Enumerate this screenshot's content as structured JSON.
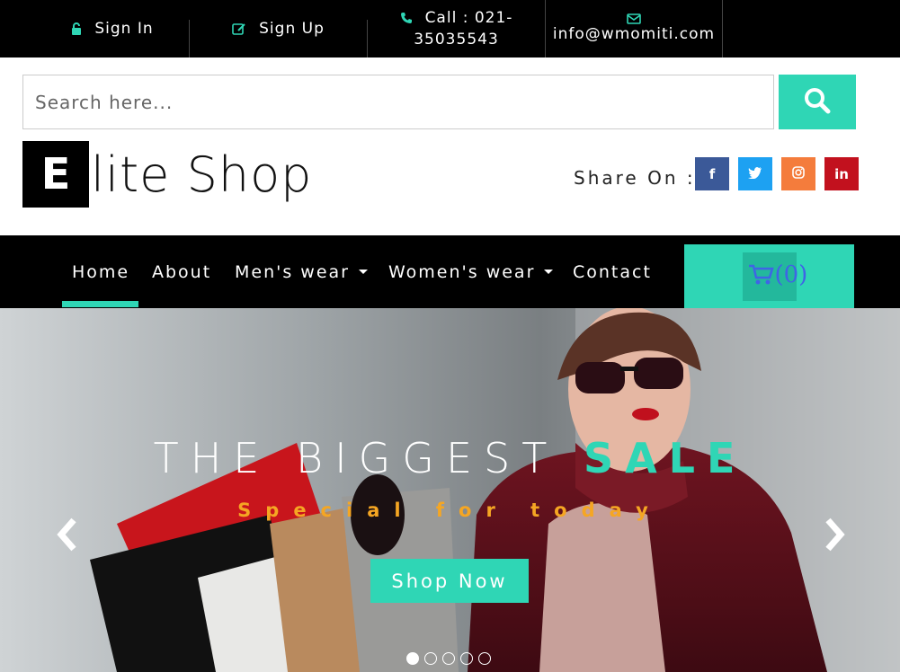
{
  "topbar": {
    "sign_in": "Sign In",
    "sign_up": "Sign Up",
    "call_line1": "Call : 021-",
    "call_line2": "35035543",
    "email": "info@wmomiti.com"
  },
  "search": {
    "placeholder": "Search here..."
  },
  "logo": {
    "letter": "E",
    "text": "lite Shop"
  },
  "share": {
    "label": "Share On :",
    "networks": [
      {
        "name": "facebook",
        "glyph": "f",
        "color": "#3b5998"
      },
      {
        "name": "twitter",
        "glyph": "t",
        "color": "#1da1f2"
      },
      {
        "name": "instagram",
        "glyph": "◎",
        "color": "#f47c3c"
      },
      {
        "name": "linkedin",
        "glyph": "in",
        "color": "#c2111e"
      }
    ]
  },
  "nav": {
    "items": [
      "Home",
      "About",
      "Men's wear",
      "Women's wear",
      "Contact"
    ],
    "active": "Home",
    "cart_count": "(0)"
  },
  "hero": {
    "title_main": "THE BIGGEST",
    "title_accent": "SALE",
    "subtitle": "Special for today",
    "cta": "Shop Now",
    "slides": 5,
    "active_slide": 1
  },
  "colors": {
    "accent": "#2fd6b5",
    "subtitle": "#f5a623",
    "topbar_bg": "#000000"
  }
}
